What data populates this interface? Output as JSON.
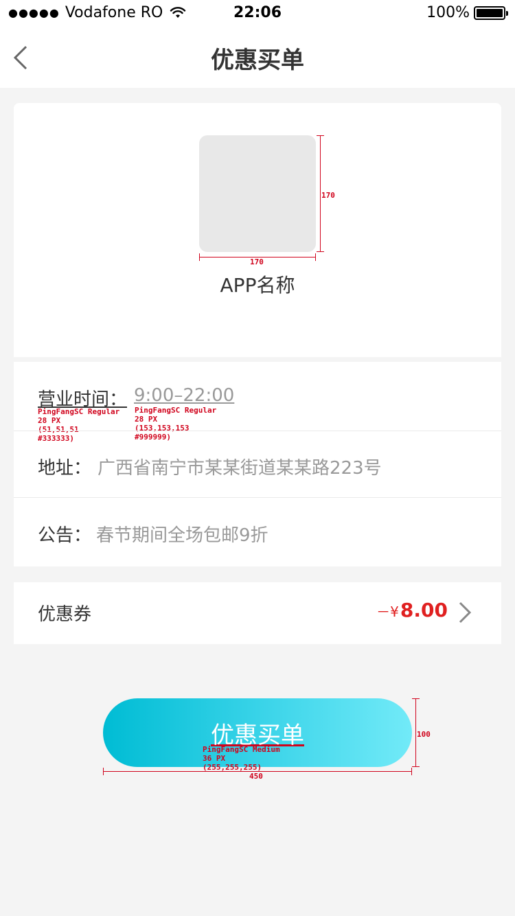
{
  "status_bar": {
    "signal_dots": "●●●●●",
    "carrier": "Vodafone RO",
    "time": "22:06",
    "battery_percent": "100%"
  },
  "nav": {
    "title": "优惠买单",
    "back_icon": "chevron-left-icon"
  },
  "shop": {
    "app_name": "APP名称",
    "icon_width_label": "170",
    "icon_height_label": "170"
  },
  "info": {
    "hours_label": "营业时间：",
    "hours_value": "9:00–22:00",
    "address_label": "地址：",
    "address_value": "广西省南宁市某某街道某某路223号",
    "notice_label": "公告：",
    "notice_value": "春节期间全场包邮9折",
    "annotation_label": [
      "PingFangSC Regular",
      "28 PX",
      "(51,51,51",
      "#333333)"
    ],
    "annotation_value": [
      "PingFangSC Regular",
      "28 PX",
      "(153,153,153",
      "#999999)"
    ]
  },
  "coupon": {
    "label": "优惠券",
    "prefix": "－¥",
    "amount": "8.00",
    "chevron_icon": "chevron-right-icon"
  },
  "pay_button": {
    "label": "优惠买单",
    "annotation": [
      "PingFangSC Medium",
      "36 PX",
      "(255,255,255)"
    ],
    "height_label": "100",
    "width_label": "450"
  },
  "colors": {
    "accent_red": "#e02020",
    "button_gradient_start": "#00bcd4",
    "button_gradient_end": "#72eaf8",
    "primary_text": "#333333",
    "secondary_text": "#999999"
  }
}
